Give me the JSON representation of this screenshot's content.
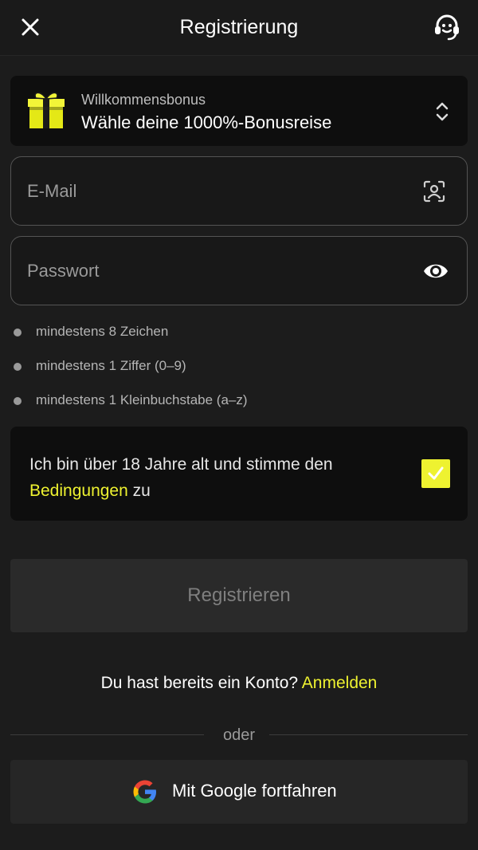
{
  "header": {
    "title": "Registrierung",
    "close_icon": "close-icon",
    "support_icon": "headset-support-icon"
  },
  "bonus": {
    "label": "Willkommensbonus",
    "value": "Wähle deine 1000%-Bonusreise",
    "icon": "gift-icon",
    "selector_icon": "chevron-up-down-icon"
  },
  "form": {
    "email": {
      "placeholder": "E-Mail",
      "value": "",
      "icon": "contact-icon"
    },
    "password": {
      "placeholder": "Passwort",
      "value": "",
      "icon": "eye-icon"
    }
  },
  "requirements": [
    "mindestens 8 Zeichen",
    "mindestens 1 Ziffer (0–9)",
    "mindestens 1 Kleinbuchstabe (a–z)"
  ],
  "terms": {
    "text_before": "Ich bin über 18 Jahre alt und stimme den ",
    "link": "Bedingungen",
    "text_after": " zu",
    "checked": true
  },
  "register_button": "Registrieren",
  "login": {
    "prompt": "Du hast bereits ein Konto? ",
    "link": "Anmelden"
  },
  "divider_text": "oder",
  "google_button": {
    "label": "Mit Google fortfahren",
    "icon": "google-icon"
  },
  "colors": {
    "accent": "#eef230",
    "background": "#1c1c1c",
    "panel": "#0e0e0e"
  }
}
